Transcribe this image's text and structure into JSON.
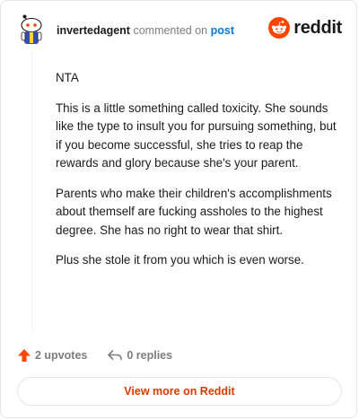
{
  "comment": {
    "author": "invertedagent",
    "action_text": "commented on",
    "post_link": "post",
    "paragraphs": [
      "NTA",
      "This is a little something called toxicity. She sounds like the type to insult you for pursuing something, but if you become successful, she tries to reap the rewards and glory because she's your parent.",
      "Parents who make their children's accomplishments about themself are fucking assholes to the highest degree. She has no right to wear that shirt.",
      "Plus she stole it from you which is even worse."
    ]
  },
  "brand": {
    "name": "reddit",
    "color": "#ff4500"
  },
  "actions": {
    "upvotes": "2 upvotes",
    "replies": "0 replies"
  },
  "footer": {
    "view_more": "View more on Reddit"
  },
  "colors": {
    "accent": "#d93a00",
    "link": "#0079d3",
    "muted": "#7c7c7c"
  }
}
